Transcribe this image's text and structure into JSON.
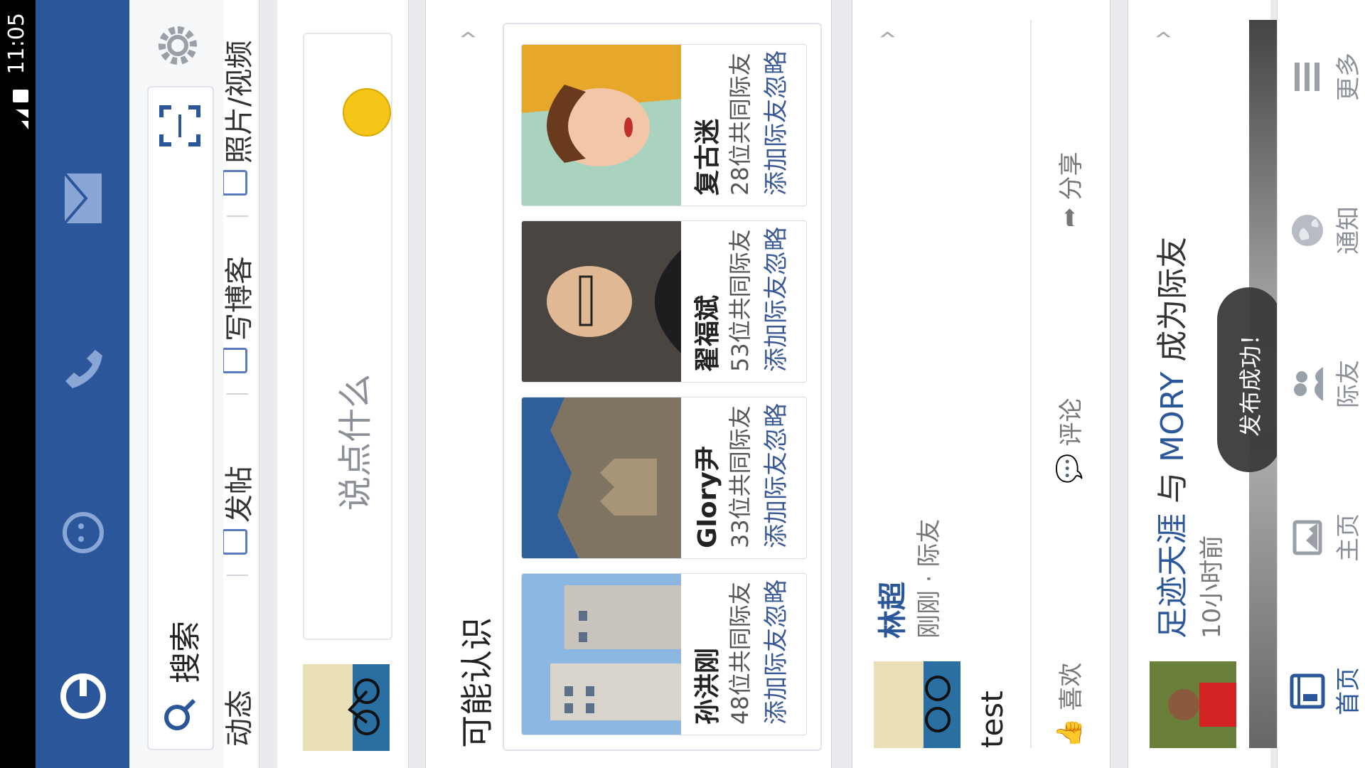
{
  "status": {
    "time": "11:05"
  },
  "search": {
    "label": "搜索"
  },
  "composer": {
    "tabs": [
      "动态",
      "发帖",
      "写博客",
      "照片/视频"
    ]
  },
  "postbox": {
    "placeholder": "说点什么"
  },
  "pymk": {
    "title": "可能认识",
    "cards": [
      {
        "name": "孙洪刚",
        "mutual": "48位共同际友",
        "add": "添加际友",
        "ignore": "忽略"
      },
      {
        "name": "Glory尹",
        "mutual": "33位共同际友",
        "add": "添加际友",
        "ignore": "忽略"
      },
      {
        "name": "翟福斌",
        "mutual": "53位共同际友",
        "add": "添加际友",
        "ignore": "忽略"
      },
      {
        "name": "复古迷",
        "mutual": "28位共同际友",
        "add": "添加际友",
        "ignore": "忽略"
      }
    ]
  },
  "post": {
    "author": "林超",
    "time": "刚刚",
    "dot": "·",
    "audience": "际友",
    "text": "test",
    "actions": {
      "like": "喜欢",
      "comment": "评论",
      "share": "分享"
    }
  },
  "story": {
    "person1": "足迹天涯",
    "connector": "与",
    "person2": "MORY",
    "suffix": "成为际友",
    "time": "10小时前"
  },
  "toast": {
    "text": "发布成功！"
  },
  "nav": {
    "home": "首页",
    "profile": "主页",
    "friends": "际友",
    "notify": "通知",
    "more": "更多"
  },
  "colors": {
    "brand": "#2b579a",
    "link": "#3b5998"
  }
}
